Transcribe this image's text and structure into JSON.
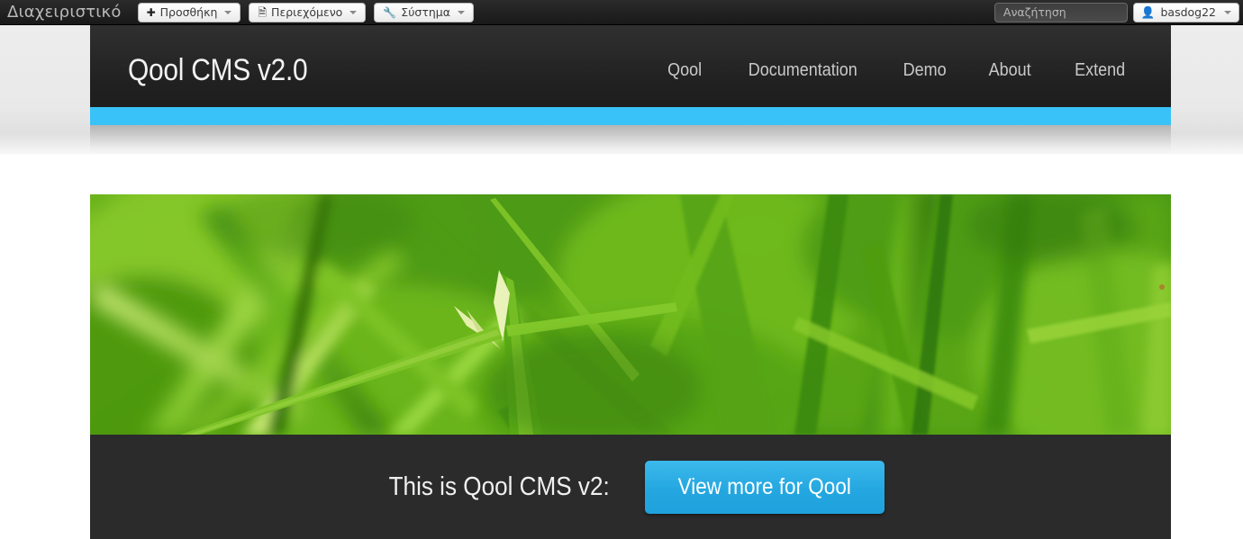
{
  "admin_bar": {
    "brand": "Διαχειριστικό",
    "buttons": [
      {
        "label": "Προσθήκη",
        "icon": "plus-icon",
        "glyph": "✚"
      },
      {
        "label": "Περιεχόμενο",
        "icon": "document-icon",
        "glyph": "🗎"
      },
      {
        "label": "Σύστημα",
        "icon": "wrench-icon",
        "glyph": "🔧"
      }
    ],
    "search": {
      "placeholder": "Αναζήτηση",
      "value": ""
    },
    "user": {
      "name": "basdog22",
      "icon": "user-icon",
      "glyph": "👤"
    }
  },
  "site_header": {
    "logo": "Qool CMS v2.0",
    "nav": [
      {
        "label": "Qool"
      },
      {
        "label": "Documentation"
      },
      {
        "label": "Demo"
      },
      {
        "label": "About"
      },
      {
        "label": "Extend"
      }
    ],
    "accent_color": "#39c2f7"
  },
  "hero": {
    "image_alt": "close-up photo of green grass blades",
    "caption": "This is Qool CMS v2:",
    "cta_label": "View more for Qool",
    "cta_color": "#24a7e0"
  }
}
